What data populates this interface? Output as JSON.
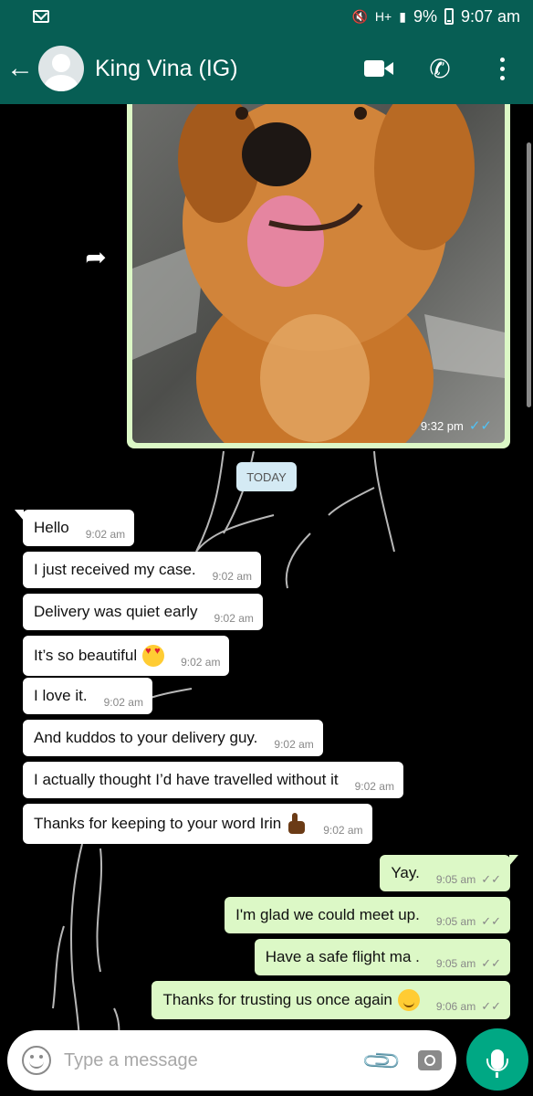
{
  "status_bar": {
    "network": "H+",
    "battery": "9%",
    "time": "9:07 am"
  },
  "header": {
    "contact_name": "King Vina (IG)"
  },
  "image_message": {
    "time": "9:32 pm",
    "ticks": "✓✓"
  },
  "date_chip": "TODAY",
  "incoming": [
    {
      "text": "Hello",
      "time": "9:02 am"
    },
    {
      "text": "I just received my case.",
      "time": "9:02 am"
    },
    {
      "text": "Delivery was quiet early",
      "time": "9:02 am"
    },
    {
      "text": "It’s so beautiful",
      "time": "9:02 am"
    },
    {
      "text": "I love it.",
      "time": "9:02 am"
    },
    {
      "text": "And kuddos to your delivery guy.",
      "time": "9:02 am"
    },
    {
      "text": "I actually thought I’d have travelled without it",
      "time": "9:02 am"
    },
    {
      "text": "Thanks for keeping to your word Irin",
      "time": "9:02 am"
    }
  ],
  "outgoing": [
    {
      "text": "Yay.",
      "time": "9:05 am",
      "ticks": "✓✓"
    },
    {
      "text": "I'm glad we could meet up.",
      "time": "9:05 am",
      "ticks": "✓✓"
    },
    {
      "text": "Have a safe flight ma .",
      "time": "9:05 am",
      "ticks": "✓✓"
    },
    {
      "text": "Thanks for trusting us once again",
      "time": "9:06 am",
      "ticks": "✓✓"
    }
  ],
  "composer": {
    "placeholder": "Type a message"
  },
  "colors": {
    "header": "#075e54",
    "outgoing_bubble": "#dcf8c6",
    "incoming_bubble": "#ffffff",
    "mic_button": "#00a884",
    "read_ticks": "#4fc3f7"
  },
  "icons": [
    "mail-icon",
    "mute-icon",
    "signal-icon",
    "battery-icon",
    "back-arrow-icon",
    "avatar",
    "video-call-icon",
    "phone-icon",
    "menu-icon",
    "forward-icon",
    "smiley-icon",
    "attach-icon",
    "camera-icon",
    "mic-icon"
  ]
}
